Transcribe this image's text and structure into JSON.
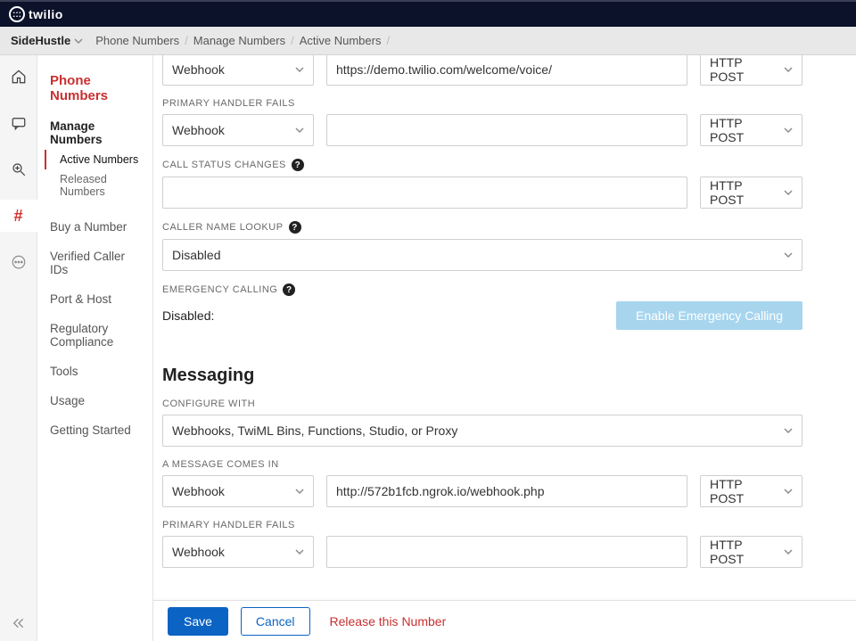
{
  "brand": {
    "name": "twilio"
  },
  "account": {
    "name": "SideHustle"
  },
  "breadcrumbs": [
    {
      "label": "Phone Numbers"
    },
    {
      "label": "Manage Numbers"
    },
    {
      "label": "Active Numbers"
    }
  ],
  "sidebar": {
    "title": "Phone Numbers",
    "manage_label": "Manage Numbers",
    "manage_sub": [
      {
        "label": "Active Numbers",
        "active": true
      },
      {
        "label": "Released Numbers",
        "active": false
      }
    ],
    "links": [
      {
        "label": "Buy a Number"
      },
      {
        "label": "Verified Caller IDs"
      },
      {
        "label": "Port & Host"
      },
      {
        "label": "Regulatory Compliance"
      },
      {
        "label": "Tools"
      },
      {
        "label": "Usage"
      },
      {
        "label": "Getting Started"
      }
    ]
  },
  "voice": {
    "call_in": {
      "type": "Webhook",
      "url": "https://demo.twilio.com/welcome/voice/",
      "method": "HTTP POST"
    },
    "primary_fail_label": "PRIMARY HANDLER FAILS",
    "primary_fail": {
      "type": "Webhook",
      "url": "",
      "method": "HTTP POST"
    },
    "status_label": "CALL STATUS CHANGES",
    "status": {
      "url": "",
      "method": "HTTP POST"
    },
    "caller_lookup_label": "CALLER NAME LOOKUP",
    "caller_lookup": "Disabled",
    "emergency_label": "EMERGENCY CALLING",
    "emergency_status": "Disabled:",
    "emergency_button": "Enable Emergency Calling"
  },
  "messaging": {
    "heading": "Messaging",
    "configure_label": "CONFIGURE WITH",
    "configure_value": "Webhooks, TwiML Bins, Functions, Studio, or Proxy",
    "message_in_label": "A MESSAGE COMES IN",
    "message_in": {
      "type": "Webhook",
      "url": "http://572b1fcb.ngrok.io/webhook.php",
      "method": "HTTP POST"
    },
    "primary_fail_label": "PRIMARY HANDLER FAILS",
    "primary_fail": {
      "type": "Webhook",
      "url": "",
      "method": "HTTP POST"
    }
  },
  "footer": {
    "save": "Save",
    "cancel": "Cancel",
    "release": "Release this Number"
  }
}
